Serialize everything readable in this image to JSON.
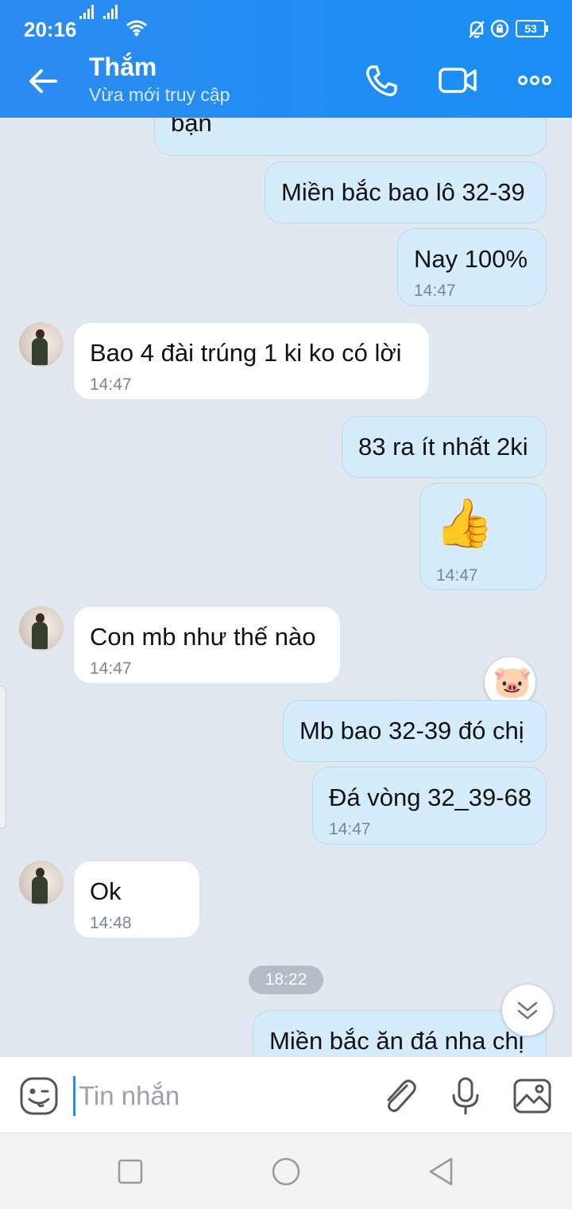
{
  "status_bar": {
    "time": "20:16",
    "battery": "53"
  },
  "header": {
    "back_icon": "arrow-left-icon",
    "contact_name": "Thắm",
    "presence": "Vừa mới truy cập",
    "call_icon": "phone-icon",
    "video_icon": "video-camera-icon",
    "more_icon": "more-horizontal-icon"
  },
  "messages": [
    {
      "side": "out",
      "text": "bạn",
      "time": ""
    },
    {
      "side": "out",
      "text": "Miền bắc bao lô 32-39",
      "time": ""
    },
    {
      "side": "out",
      "text": "Nay 100%",
      "time": "14:47"
    },
    {
      "side": "in",
      "text": "Bao 4 đài trúng 1 ki ko có lời",
      "time": "14:47"
    },
    {
      "side": "out",
      "text": "83 ra ít nhất 2ki",
      "time": ""
    },
    {
      "side": "out",
      "text": "👍",
      "time": "14:47"
    },
    {
      "side": "in",
      "text": "Con mb như thế nào",
      "time": "14:47"
    },
    {
      "side": "out",
      "text": "Mb bao 32-39 đó chị",
      "time": ""
    },
    {
      "side": "out",
      "text": "Đá vòng 32_39-68",
      "time": "14:47"
    },
    {
      "side": "in",
      "text": "Ok",
      "time": "14:48"
    },
    {
      "side": "out",
      "text": "Miền bắc ăn đá nha chị",
      "time": ""
    }
  ],
  "date_separator": "18:22",
  "reaction_emoji": "🐷",
  "input": {
    "placeholder": "Tin nhắn",
    "value": ""
  },
  "colors": {
    "header": "#1a8ef5",
    "outgoing_bubble": "#d5ecfd",
    "incoming_bubble": "#ffffff",
    "background": "#e2e8f0"
  }
}
